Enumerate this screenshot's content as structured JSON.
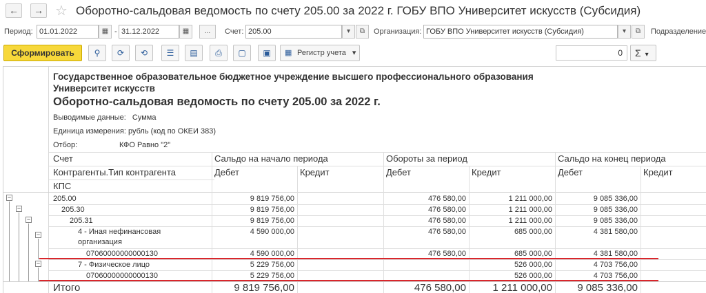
{
  "titlebar": {
    "back": "←",
    "forward": "→",
    "star": "☆",
    "title": "Оборотно-сальдовая ведомость по счету 205.00 за 2022 г. ГОБУ ВПО Университет искусств (Субсидия)"
  },
  "params": {
    "period_label": "Период:",
    "date_from": "01.01.2022",
    "date_sep": "-",
    "date_to": "31.12.2022",
    "more": "...",
    "account_label": "Счет:",
    "account": "205.00",
    "org_label": "Организация:",
    "org": "ГОБУ ВПО Университет искусств (Субсидия)",
    "division_label": "Подразделение:"
  },
  "toolbar": {
    "generate": "Сформировать",
    "register": "Регистр учета",
    "sum_value": "0",
    "sigma": "Σ"
  },
  "report": {
    "org_line1": "Государственное образовательное бюджетное учреждение высшего профессионального образования",
    "org_line2": "Университет искусств",
    "title": "Оборотно-сальдовая ведомость по счету 205.00 за 2022 г.",
    "output_label": "Выводимые данные:",
    "output_value": "Сумма",
    "unit_label": "Единица измерения:",
    "unit_value": "рубль (код по ОКЕИ 383)",
    "filter_label": "Отбор:",
    "filter_value": "КФО Равно \"2\""
  },
  "columns": {
    "account": "Счет",
    "counterparty": "Контрагенты.Тип контрагента",
    "kps": "КПС",
    "opening": "Сальдо на начало периода",
    "turnover": "Обороты за период",
    "closing": "Сальдо на конец периода",
    "debit": "Дебет",
    "credit": "Кредит"
  },
  "rows": [
    {
      "name": "205.00",
      "open_d": "9 819 756,00",
      "open_c": "",
      "turn_d": "476 580,00",
      "turn_c": "1 211 000,00",
      "close_d": "9 085 336,00",
      "close_c": ""
    },
    {
      "name": "205.30",
      "open_d": "9 819 756,00",
      "open_c": "",
      "turn_d": "476 580,00",
      "turn_c": "1 211 000,00",
      "close_d": "9 085 336,00",
      "close_c": ""
    },
    {
      "name": "205.31",
      "open_d": "9 819 756,00",
      "open_c": "",
      "turn_d": "476 580,00",
      "turn_c": "1 211 000,00",
      "close_d": "9 085 336,00",
      "close_c": ""
    },
    {
      "name": "4 - Иная нефинансовая",
      "name2": "организация",
      "open_d": "4 590 000,00",
      "open_c": "",
      "turn_d": "476 580,00",
      "turn_c": "685 000,00",
      "close_d": "4 381 580,00",
      "close_c": ""
    },
    {
      "name": "07060000000000130",
      "open_d": "4 590 000,00",
      "open_c": "",
      "turn_d": "476 580,00",
      "turn_c": "685 000,00",
      "close_d": "4 381 580,00",
      "close_c": ""
    },
    {
      "name": "7 - Физическое лицо",
      "open_d": "5 229 756,00",
      "open_c": "",
      "turn_d": "",
      "turn_c": "526 000,00",
      "close_d": "4 703 756,00",
      "close_c": ""
    },
    {
      "name": "07060000000000130",
      "open_d": "5 229 756,00",
      "open_c": "",
      "turn_d": "",
      "turn_c": "526 000,00",
      "close_d": "4 703 756,00",
      "close_c": ""
    }
  ],
  "total": {
    "label": "Итого",
    "open_d": "9 819 756,00",
    "turn_d": "476 580,00",
    "turn_c": "1 211 000,00",
    "close_d": "9 085 336,00"
  },
  "colors": {
    "primary_button": "#f7d83a",
    "highlight_line": "#d9262b"
  },
  "tree_icons": [
    "minus-box",
    "minus-box",
    "minus-box",
    "minus-box",
    "minus-box"
  ]
}
